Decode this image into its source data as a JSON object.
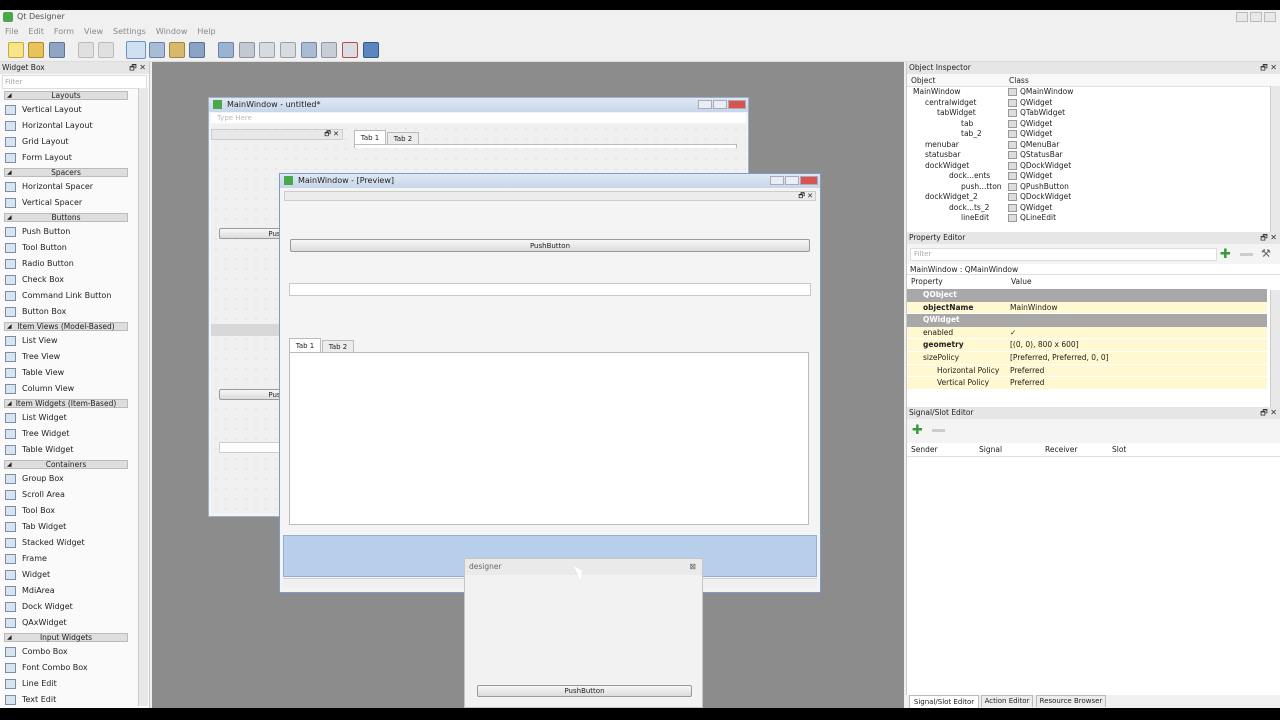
{
  "app": {
    "title": "Qt Designer"
  },
  "menu": [
    "File",
    "Edit",
    "Form",
    "View",
    "Settings",
    "Window",
    "Help"
  ],
  "toolbar_icons": [
    "new-icon",
    "open-icon",
    "save-icon",
    "copy-icon",
    "paste-icon",
    "edit-widgets-icon",
    "edit-signals-icon",
    "edit-buddies-icon",
    "edit-tab-order-icon",
    "layout-horizontal-icon",
    "layout-vertical-icon",
    "layout-horizontal-splitter-icon",
    "layout-vertical-splitter-icon",
    "layout-grid-icon",
    "layout-form-icon",
    "break-layout-icon",
    "adjust-size-icon"
  ],
  "widget_box": {
    "title": "Widget Box",
    "filter_placeholder": "Filter",
    "sections": [
      {
        "name": "Layouts",
        "items": [
          "Vertical Layout",
          "Horizontal Layout",
          "Grid Layout",
          "Form Layout"
        ]
      },
      {
        "name": "Spacers",
        "items": [
          "Horizontal Spacer",
          "Vertical Spacer"
        ]
      },
      {
        "name": "Buttons",
        "items": [
          "Push Button",
          "Tool Button",
          "Radio Button",
          "Check Box",
          "Command Link Button",
          "Button Box"
        ]
      },
      {
        "name": "Item Views (Model-Based)",
        "items": [
          "List View",
          "Tree View",
          "Table View",
          "Column View"
        ]
      },
      {
        "name": "Item Widgets (Item-Based)",
        "items": [
          "List Widget",
          "Tree Widget",
          "Table Widget"
        ]
      },
      {
        "name": "Containers",
        "items": [
          "Group Box",
          "Scroll Area",
          "Tool Box",
          "Tab Widget",
          "Stacked Widget",
          "Frame",
          "Widget",
          "MdiArea",
          "Dock Widget",
          "QAxWidget"
        ]
      },
      {
        "name": "Input Widgets",
        "items": [
          "Combo Box",
          "Font Combo Box",
          "Line Edit",
          "Text Edit"
        ]
      }
    ]
  },
  "form_window": {
    "title": "MainWindow - untitled*",
    "type_here": "Type Here",
    "tabs": [
      "Tab 1",
      "Tab 2"
    ],
    "push_label_1": "Push",
    "push_label_2": "Push"
  },
  "preview_window": {
    "title": "MainWindow - [Preview]",
    "push_button": "PushButton",
    "tabs": [
      "Tab 1",
      "Tab 2"
    ]
  },
  "floating_dock": {
    "title": "designer",
    "push_button": "PushButton"
  },
  "object_inspector": {
    "title": "Object Inspector",
    "headers": [
      "Object",
      "Class"
    ],
    "rows": [
      {
        "object": "MainWindow",
        "class": "QMainWindow"
      },
      {
        "object": "centralwidget",
        "class": "QWidget"
      },
      {
        "object": "tabWidget",
        "class": "QTabWidget"
      },
      {
        "object": "tab",
        "class": "QWidget"
      },
      {
        "object": "tab_2",
        "class": "QWidget"
      },
      {
        "object": "menubar",
        "class": "QMenuBar"
      },
      {
        "object": "statusbar",
        "class": "QStatusBar"
      },
      {
        "object": "dockWidget",
        "class": "QDockWidget"
      },
      {
        "object": "dock...ents",
        "class": "QWidget"
      },
      {
        "object": "push...tton",
        "class": "QPushButton"
      },
      {
        "object": "dockWidget_2",
        "class": "QDockWidget"
      },
      {
        "object": "dock...ts_2",
        "class": "QWidget"
      },
      {
        "object": "lineEdit",
        "class": "QLineEdit"
      }
    ]
  },
  "property_editor": {
    "title": "Property Editor",
    "filter_placeholder": "Filter",
    "context": "MainWindow : QMainWindow",
    "headers": [
      "Property",
      "Value"
    ],
    "rows": [
      {
        "prop": "QObject",
        "value": "",
        "kind": "group"
      },
      {
        "prop": "objectName",
        "value": "MainWindow",
        "kind": "bold"
      },
      {
        "prop": "QWidget",
        "value": "",
        "kind": "group"
      },
      {
        "prop": "enabled",
        "value": "✓",
        "kind": "normal"
      },
      {
        "prop": "geometry",
        "value": "[(0, 0), 800 x 600]",
        "kind": "bold"
      },
      {
        "prop": "sizePolicy",
        "value": "[Preferred, Preferred, 0, 0]",
        "kind": "normal"
      },
      {
        "prop": "Horizontal Policy",
        "value": "Preferred",
        "kind": "sub"
      },
      {
        "prop": "Vertical Policy",
        "value": "Preferred",
        "kind": "sub"
      }
    ]
  },
  "signal_slot_editor": {
    "title": "Signal/Slot Editor",
    "headers": [
      "Sender",
      "Signal",
      "Receiver",
      "Slot"
    ]
  },
  "bottom_tabs": [
    "Signal/Slot Editor",
    "Action Editor",
    "Resource Browser"
  ],
  "colors": {
    "accent": "#c7d6ea",
    "property_bg": "#fff8d0",
    "group_bg": "#a8a8a8",
    "mdi_bg": "#8c8c8c"
  }
}
